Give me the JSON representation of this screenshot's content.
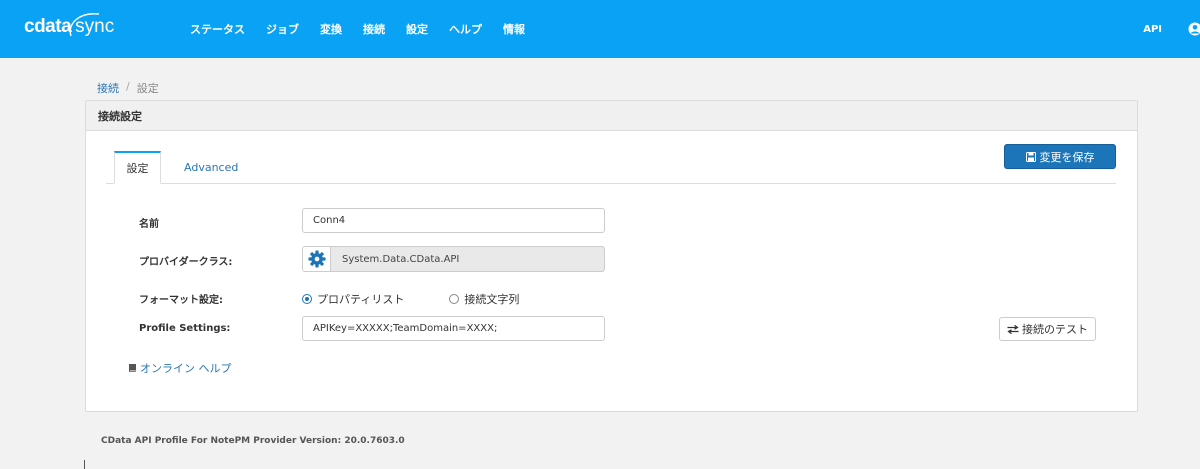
{
  "app": {
    "logo_main": "cdata",
    "logo_sub": "sync"
  },
  "nav": {
    "items": [
      "ステータス",
      "ジョブ",
      "変換",
      "接続",
      "設定",
      "ヘルプ",
      "情報"
    ],
    "api_label": "API"
  },
  "breadcrumb": {
    "link": "接続",
    "separator": "/",
    "current": "設定"
  },
  "panel": {
    "title": "接続設定"
  },
  "tabs": {
    "settings": "設定",
    "advanced": "Advanced"
  },
  "buttons": {
    "save": "変更を保存",
    "test": "接続のテスト"
  },
  "form": {
    "name_label": "名前",
    "name_value": "Conn4",
    "provider_label": "プロバイダークラス:",
    "provider_value": "System.Data.CData.API",
    "format_label": "フォーマット設定:",
    "format_option_1": "プロパティリスト",
    "format_option_2": "接続文字列",
    "format_selected": "プロパティリスト",
    "profile_label": "Profile Settings:",
    "profile_value": "APIKey=XXXXX;TeamDomain=XXXX;"
  },
  "help": {
    "label": "オンライン ヘルプ"
  },
  "footer": {
    "version_text": "CData API Profile For NotePM Provider Version: 20.0.7603.0"
  },
  "colors": {
    "nav_bg": "#0aa2f5",
    "primary_button": "#1d75b9",
    "link": "#2a76b6"
  },
  "icons": {
    "save": "floppy-disk-icon",
    "test": "exchange-arrows-icon",
    "help": "book-icon",
    "provider": "gear-icon",
    "user": "user-icon"
  }
}
